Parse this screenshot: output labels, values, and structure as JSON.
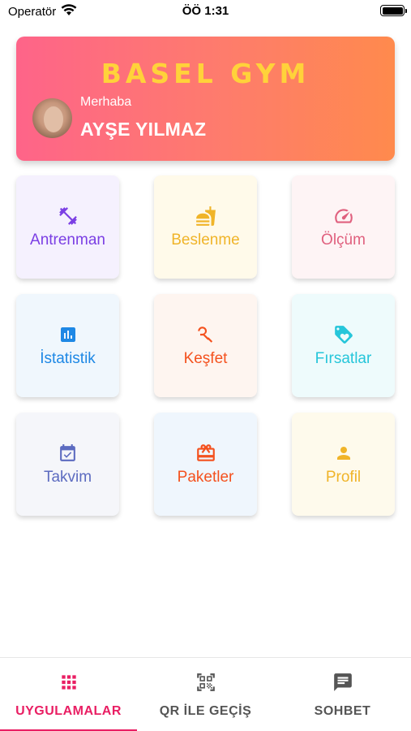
{
  "status_bar": {
    "carrier": "Operatör",
    "time": "ÖÖ 1:31"
  },
  "header": {
    "brand": "BASEL GYM",
    "greeting": "Merhaba",
    "user_name": "AYŞE YILMAZ"
  },
  "tiles": [
    {
      "label": "Antrenman",
      "icon": "dumbbell-icon",
      "color": "#7b3fe4",
      "bg": "#f5f1fe"
    },
    {
      "label": "Beslenme",
      "icon": "fastfood-icon",
      "color": "#f0b429",
      "bg": "#fffaea"
    },
    {
      "label": "Ölçüm",
      "icon": "speedometer-icon",
      "color": "#e0607e",
      "bg": "#fef4f5"
    },
    {
      "label": "İstatistik",
      "icon": "chart-icon",
      "color": "#1e88e5",
      "bg": "#f0f7fd"
    },
    {
      "label": "Keşfet",
      "icon": "explore-icon",
      "color": "#f4511e",
      "bg": "#fef5f0"
    },
    {
      "label": "Fırsatlar",
      "icon": "tag-icon",
      "color": "#26c6da",
      "bg": "#eefbfc"
    },
    {
      "label": "Takvim",
      "icon": "calendar-icon",
      "color": "#5c6bc0",
      "bg": "#f5f6fa"
    },
    {
      "label": "Paketler",
      "icon": "gift-icon",
      "color": "#f4511e",
      "bg": "#eff6fd"
    },
    {
      "label": "Profil",
      "icon": "person-icon",
      "color": "#f0b429",
      "bg": "#fefaec"
    }
  ],
  "bottom_nav": {
    "items": [
      {
        "label": "UYGULAMALAR",
        "icon": "apps-grid-icon",
        "active": true
      },
      {
        "label": "QR İLE GEÇİŞ",
        "icon": "qr-code-icon",
        "active": false
      },
      {
        "label": "SOHBET",
        "icon": "chat-icon",
        "active": false
      }
    ],
    "active_color": "#e91e63",
    "inactive_color": "#555555"
  }
}
